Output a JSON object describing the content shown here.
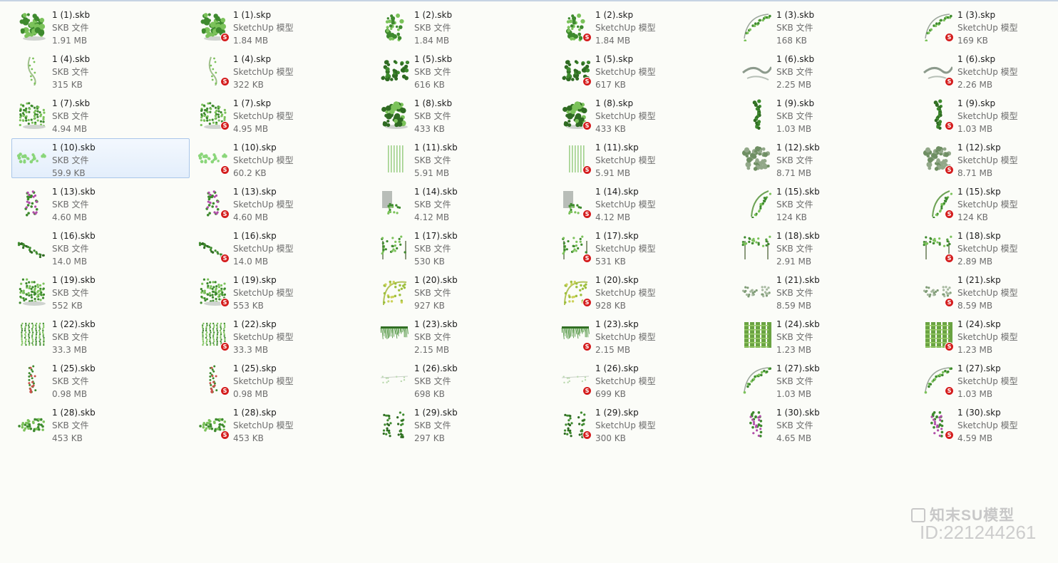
{
  "files": [
    {
      "name": "1 (1).skb",
      "type": "SKB 文件",
      "size": "1.91 MB",
      "kind": "skb",
      "thumb": "dense-shrub"
    },
    {
      "name": "1 (1).skp",
      "type": "SketchUp 模型",
      "size": "1.84 MB",
      "kind": "skp",
      "thumb": "dense-shrub"
    },
    {
      "name": "1 (2).skb",
      "type": "SKB 文件",
      "size": "1.84 MB",
      "kind": "skb",
      "thumb": "climber-cluster"
    },
    {
      "name": "1 (2).skp",
      "type": "SketchUp 模型",
      "size": "1.84 MB",
      "kind": "skp",
      "thumb": "climber-cluster"
    },
    {
      "name": "1 (3).skb",
      "type": "SKB 文件",
      "size": "168 KB",
      "kind": "skb",
      "thumb": "arch-vine"
    },
    {
      "name": "1 (3).skp",
      "type": "SketchUp 模型",
      "size": "169 KB",
      "kind": "skp",
      "thumb": "arch-vine"
    },
    {
      "name": "1 (4).skb",
      "type": "SKB 文件",
      "size": "315 KB",
      "kind": "skb",
      "thumb": "thin-vine"
    },
    {
      "name": "1 (4).skp",
      "type": "SketchUp 模型",
      "size": "322 KB",
      "kind": "skp",
      "thumb": "thin-vine"
    },
    {
      "name": "1 (5).skb",
      "type": "SKB 文件",
      "size": "616 KB",
      "kind": "skb",
      "thumb": "shrub-row"
    },
    {
      "name": "1 (5).skp",
      "type": "SketchUp 模型",
      "size": "617 KB",
      "kind": "skp",
      "thumb": "shrub-row"
    },
    {
      "name": "1 (6).skb",
      "type": "SKB 文件",
      "size": "2.25 MB",
      "kind": "skb",
      "thumb": "grey-branch"
    },
    {
      "name": "1 (6).skp",
      "type": "SketchUp 模型",
      "size": "2.26 MB",
      "kind": "skp",
      "thumb": "grey-branch"
    },
    {
      "name": "1 (7).skb",
      "type": "SKB 文件",
      "size": "4.94 MB",
      "kind": "skb",
      "thumb": "hanging-curtain"
    },
    {
      "name": "1 (7).skp",
      "type": "SketchUp 模型",
      "size": "4.95 MB",
      "kind": "skp",
      "thumb": "hanging-curtain"
    },
    {
      "name": "1 (8).skb",
      "type": "SKB 文件",
      "size": "433 KB",
      "kind": "skb",
      "thumb": "dark-shrub"
    },
    {
      "name": "1 (8).skp",
      "type": "SketchUp 模型",
      "size": "433 KB",
      "kind": "skp",
      "thumb": "dark-shrub"
    },
    {
      "name": "1 (9).skb",
      "type": "SKB 文件",
      "size": "1.03 MB",
      "kind": "skb",
      "thumb": "column-vine"
    },
    {
      "name": "1 (9).skp",
      "type": "SketchUp 模型",
      "size": "1.03 MB",
      "kind": "skp",
      "thumb": "column-vine"
    },
    {
      "name": "1 (10).skb",
      "type": "SKB 文件",
      "size": "59.9 KB",
      "kind": "skb",
      "thumb": "light-spray",
      "selected": true
    },
    {
      "name": "1 (10).skp",
      "type": "SketchUp 模型",
      "size": "60.2 KB",
      "kind": "skp",
      "thumb": "light-spray"
    },
    {
      "name": "1 (11).skb",
      "type": "SKB 文件",
      "size": "5.91 MB",
      "kind": "skb",
      "thumb": "bamboo"
    },
    {
      "name": "1 (11).skp",
      "type": "SketchUp 模型",
      "size": "5.91 MB",
      "kind": "skp",
      "thumb": "bamboo"
    },
    {
      "name": "1 (12).skb",
      "type": "SKB 文件",
      "size": "8.71 MB",
      "kind": "skb",
      "thumb": "grey-bush"
    },
    {
      "name": "1 (12).skp",
      "type": "SketchUp 模型",
      "size": "8.71 MB",
      "kind": "skp",
      "thumb": "grey-bush"
    },
    {
      "name": "1 (13).skb",
      "type": "SKB 文件",
      "size": "4.60 MB",
      "kind": "skb",
      "thumb": "purple-flower"
    },
    {
      "name": "1 (13).skp",
      "type": "SketchUp 模型",
      "size": "4.60 MB",
      "kind": "skp",
      "thumb": "purple-flower"
    },
    {
      "name": "1 (14).skb",
      "type": "SKB 文件",
      "size": "4.12 MB",
      "kind": "skb",
      "thumb": "wall-plant"
    },
    {
      "name": "1 (14).skp",
      "type": "SketchUp 模型",
      "size": "4.12 MB",
      "kind": "skp",
      "thumb": "wall-plant"
    },
    {
      "name": "1 (15).skb",
      "type": "SKB 文件",
      "size": "124 KB",
      "kind": "skb",
      "thumb": "leaning-vine"
    },
    {
      "name": "1 (15).skp",
      "type": "SketchUp 模型",
      "size": "124 KB",
      "kind": "skp",
      "thumb": "leaning-vine"
    },
    {
      "name": "1 (16).skb",
      "type": "SKB 文件",
      "size": "14.0 MB",
      "kind": "skb",
      "thumb": "diagonal-branch"
    },
    {
      "name": "1 (16).skp",
      "type": "SketchUp 模型",
      "size": "14.0 MB",
      "kind": "skp",
      "thumb": "diagonal-branch"
    },
    {
      "name": "1 (17).skb",
      "type": "SKB 文件",
      "size": "530 KB",
      "kind": "skb",
      "thumb": "pergola"
    },
    {
      "name": "1 (17).skp",
      "type": "SketchUp 模型",
      "size": "531 KB",
      "kind": "skp",
      "thumb": "pergola"
    },
    {
      "name": "1 (18).skb",
      "type": "SKB 文件",
      "size": "2.91 MB",
      "kind": "skb",
      "thumb": "arbor"
    },
    {
      "name": "1 (18).skp",
      "type": "SketchUp 模型",
      "size": "2.89 MB",
      "kind": "skp",
      "thumb": "arbor"
    },
    {
      "name": "1 (19).skb",
      "type": "SKB 文件",
      "size": "552 KB",
      "kind": "skb",
      "thumb": "hanging-curtain"
    },
    {
      "name": "1 (19).skp",
      "type": "SketchUp 模型",
      "size": "553 KB",
      "kind": "skp",
      "thumb": "hanging-curtain"
    },
    {
      "name": "1 (20).skb",
      "type": "SKB 文件",
      "size": "927 KB",
      "kind": "skb",
      "thumb": "yellow-arch"
    },
    {
      "name": "1 (20).skp",
      "type": "SketchUp 模型",
      "size": "928 KB",
      "kind": "skp",
      "thumb": "yellow-arch"
    },
    {
      "name": "1 (21).skb",
      "type": "SKB 文件",
      "size": "8.59 MB",
      "kind": "skb",
      "thumb": "low-hedge"
    },
    {
      "name": "1 (21).skp",
      "type": "SketchUp 模型",
      "size": "8.59 MB",
      "kind": "skp",
      "thumb": "low-hedge"
    },
    {
      "name": "1 (22).skb",
      "type": "SKB 文件",
      "size": "33.3 MB",
      "kind": "skb",
      "thumb": "hanging-strands"
    },
    {
      "name": "1 (22).skp",
      "type": "SketchUp 模型",
      "size": "33.3 MB",
      "kind": "skp",
      "thumb": "hanging-strands"
    },
    {
      "name": "1 (23).skb",
      "type": "SKB 文件",
      "size": "2.15 MB",
      "kind": "skb",
      "thumb": "fringe"
    },
    {
      "name": "1 (23).skp",
      "type": "SketchUp 模型",
      "size": "2.15 MB",
      "kind": "skp",
      "thumb": "fringe"
    },
    {
      "name": "1 (24).skb",
      "type": "SKB 文件",
      "size": "1.23 MB",
      "kind": "skb",
      "thumb": "green-wall"
    },
    {
      "name": "1 (24).skp",
      "type": "SketchUp 模型",
      "size": "1.23 MB",
      "kind": "skp",
      "thumb": "green-wall"
    },
    {
      "name": "1 (25).skb",
      "type": "SKB 文件",
      "size": "0.98 MB",
      "kind": "skb",
      "thumb": "red-flower-vine"
    },
    {
      "name": "1 (25).skp",
      "type": "SketchUp 模型",
      "size": "0.98 MB",
      "kind": "skp",
      "thumb": "red-flower-vine"
    },
    {
      "name": "1 (26).skb",
      "type": "SKB 文件",
      "size": "698 KB",
      "kind": "skb",
      "thumb": "faint-vine"
    },
    {
      "name": "1 (26).skp",
      "type": "SketchUp 模型",
      "size": "699 KB",
      "kind": "skp",
      "thumb": "faint-vine"
    },
    {
      "name": "1 (27).skb",
      "type": "SKB 文件",
      "size": "1.03 MB",
      "kind": "skb",
      "thumb": "arch-vine"
    },
    {
      "name": "1 (27).skp",
      "type": "SketchUp 模型",
      "size": "1.03 MB",
      "kind": "skp",
      "thumb": "arch-vine"
    },
    {
      "name": "1 (28).skb",
      "type": "SKB 文件",
      "size": "453 KB",
      "kind": "skb",
      "thumb": "hedge"
    },
    {
      "name": "1 (28).skp",
      "type": "SketchUp 模型",
      "size": "453 KB",
      "kind": "skp",
      "thumb": "hedge"
    },
    {
      "name": "1 (29).skb",
      "type": "SKB 文件",
      "size": "297 KB",
      "kind": "skb",
      "thumb": "tall-panels"
    },
    {
      "name": "1 (29).skp",
      "type": "SketchUp 模型",
      "size": "300 KB",
      "kind": "skp",
      "thumb": "tall-panels"
    },
    {
      "name": "1 (30).skb",
      "type": "SKB 文件",
      "size": "4.65 MB",
      "kind": "skb",
      "thumb": "purple-flower"
    },
    {
      "name": "1 (30).skp",
      "type": "SketchUp 模型",
      "size": "4.59 MB",
      "kind": "skp",
      "thumb": "purple-flower"
    }
  ],
  "sketchup_badge": "S",
  "watermark": {
    "logo_text": "知末SU模型",
    "id_text": "ID:221244261"
  },
  "colors": {
    "foliage": "#3e8a2e",
    "foliage_light": "#7bc25a",
    "flower_purple": "#b04ca8",
    "flower_red": "#c8524a",
    "badge_red": "#d41e1e"
  }
}
